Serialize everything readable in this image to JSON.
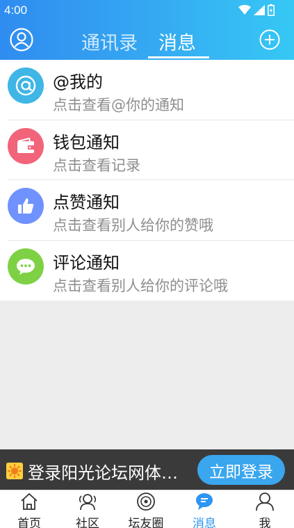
{
  "status": {
    "time": "4:00"
  },
  "header": {
    "tabs": [
      {
        "label": "通讯录",
        "active": false
      },
      {
        "label": "消息",
        "active": true
      }
    ]
  },
  "messages": [
    {
      "title": "@我的",
      "subtitle": "点击查看@你的通知",
      "icon": "at-icon",
      "color": "#3fb6e6"
    },
    {
      "title": "钱包通知",
      "subtitle": "点击查看记录",
      "icon": "wallet-icon",
      "color": "#f2647a"
    },
    {
      "title": "点赞通知",
      "subtitle": "点击查看别人给你的赞哦",
      "icon": "thumbs-up-icon",
      "color": "#6f92ff"
    },
    {
      "title": "评论通知",
      "subtitle": "点击查看别人给你的评论哦",
      "icon": "chat-bubble-icon",
      "color": "#7ed145"
    }
  ],
  "banner": {
    "text": "登录阳光论坛网体…",
    "button": "立即登录"
  },
  "bottom_nav": [
    {
      "label": "首页",
      "icon": "home-icon",
      "active": false
    },
    {
      "label": "社区",
      "icon": "community-icon",
      "active": false
    },
    {
      "label": "坛友圈",
      "icon": "circle-icon",
      "active": false
    },
    {
      "label": "消息",
      "icon": "message-icon",
      "active": true
    },
    {
      "label": "我",
      "icon": "profile-icon",
      "active": false
    }
  ],
  "colors": {
    "accent": "#2e95f2",
    "header_start": "#2f8cf0",
    "header_end": "#36c8f4"
  }
}
